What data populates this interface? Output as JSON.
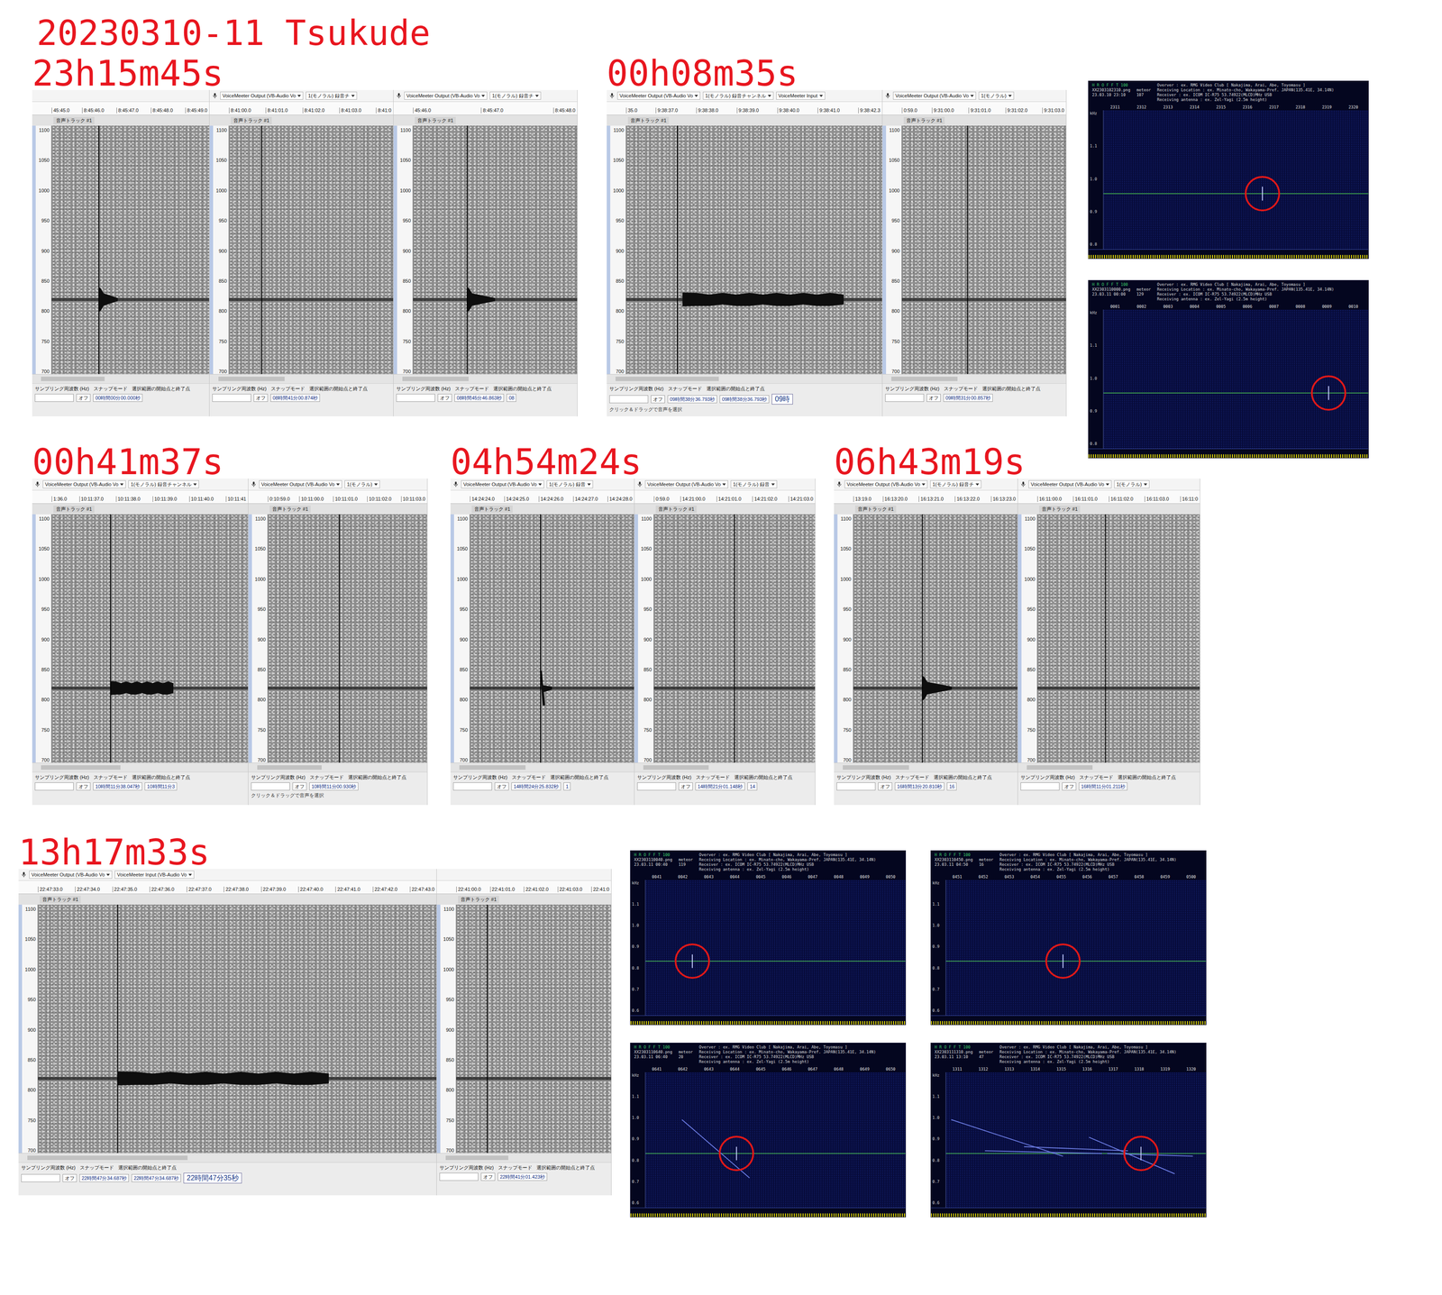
{
  "title": "20230310-11 Tsukude",
  "spectrogram": {
    "track_label": "音声トラック #1",
    "y_ticks": [
      "1100",
      "1050",
      "1000",
      "950",
      "900",
      "850",
      "800",
      "750",
      "700"
    ],
    "toolbar_labels": [
      "サンプリング周波数 (Hz)",
      "スナップモード",
      "選択範囲の開始点と終了点"
    ],
    "snap": "オフ"
  },
  "groups": [
    {
      "label": "23h15m45s",
      "panels": [
        {
          "header": [],
          "ruler": [
            "45:45.0",
            "8:45:46.0",
            "8:45:47.0",
            "8:45:48.0",
            "8:45:49.0"
          ],
          "cursor": 0.3,
          "echo": {
            "kind": "blob",
            "start": 0.3,
            "end": 0.42
          },
          "times": [
            "00時間00分00.000秒"
          ]
        },
        {
          "header": [
            "VoiceMeeter Output (VB-Audio Vo",
            "1(モノラル) 録音チ"
          ],
          "ruler": [
            "8:41:00.0",
            "8:41:01.0",
            "8:41:02.0",
            "8:41:03.0",
            "8:41:0"
          ],
          "cursor": 0.2,
          "echo": {
            "kind": "none",
            "start": 0.2,
            "end": 0.2
          },
          "times": [
            "08時間41分00.874秒"
          ]
        },
        {
          "header": [
            "VoiceMeeter Output (VB-Audio Vo",
            "1(モノラル) 録音チ"
          ],
          "ruler": [
            "45:46.0",
            "8:45:47.0",
            "8:45:48.0"
          ],
          "cursor": 0.33,
          "echo": {
            "kind": "blob",
            "start": 0.33,
            "end": 0.5
          },
          "times": [
            "08時間45分46.863秒",
            "08"
          ]
        }
      ]
    },
    {
      "label": "00h08m35s",
      "panels": [
        {
          "header": [
            "VoiceMeeter Output (VB-Audio Vo",
            "1(モノラル) 録音チャンネル",
            "VoiceMeeter Input"
          ],
          "ruler": [
            "35.0",
            "9:38:37.0",
            "9:38:38.0",
            "9:38:39.0",
            "9:38:40.0",
            "9:38:41.0",
            "9:38:42.3"
          ],
          "cursor": 0.2,
          "echo": {
            "kind": "long",
            "start": 0.22,
            "end": 0.85
          },
          "times": [
            "09時間38分36.793秒",
            "09時間38分36.793秒"
          ],
          "overlay": "09時",
          "status": "クリック＆ドラッグで音声を選択"
        },
        {
          "header": [
            "VoiceMeeter Output (VB-Audio Vo",
            "1(モノラル)"
          ],
          "ruler": [
            "0:59.0",
            "9:31:00.0",
            "9:31:01.0",
            "9:31:02.0",
            "9:31:03.0"
          ],
          "cursor": 0.4,
          "echo": {
            "kind": "none",
            "start": 0.4,
            "end": 0.4
          },
          "times": [
            "09時間31分00.857秒"
          ]
        }
      ]
    },
    {
      "label": "00h41m37s",
      "panels": [
        {
          "header": [
            "VoiceMeeter Output (VB-Audio Vo",
            "1(モノラル) 録音チャンネル"
          ],
          "ruler": [
            "1:36.0",
            "10:11:37.0",
            "10:11:38.0",
            "10:11:39.0",
            "10:11:40.0",
            "10:11:41"
          ],
          "cursor": 0.3,
          "echo": {
            "kind": "long",
            "start": 0.3,
            "end": 0.62
          },
          "times": [
            "10時間11分38.047秒",
            "10時間11分3"
          ]
        },
        {
          "header": [
            "VoiceMeeter Output (VB-Audio Vo",
            "1(モノラル)"
          ],
          "ruler": [
            "0:10:59.0",
            "10:11:00.0",
            "10:11:01.0",
            "10:11:02.0",
            "10:11:03.0"
          ],
          "cursor": 0.45,
          "echo": {
            "kind": "none",
            "start": 0.45,
            "end": 0.45
          },
          "times": [
            "10時間11分00.930秒"
          ],
          "status": "クリック＆ドラッグで音声を選択"
        }
      ]
    },
    {
      "label": "04h54m24s",
      "panels": [
        {
          "header": [
            "VoiceMeeter Output (VB-Audio Vo",
            "1(モノラル) 録音"
          ],
          "ruler": [
            "14:24:24.0",
            "14:24:25.0",
            "14:24:26.0",
            "14:24:27.0",
            "14:24:28.0"
          ],
          "cursor": 0.43,
          "echo": {
            "kind": "head",
            "start": 0.43,
            "end": 0.5
          },
          "times": [
            "14時間24分25.832秒",
            "1"
          ]
        },
        {
          "header": [
            "VoiceMeeter Output (VB-Audio Vo",
            "1(モノラル) 録音"
          ],
          "ruler": [
            "0:59.0",
            "14:21:00.0",
            "14:21:01.0",
            "14:21:02.0",
            "14:21:03.0"
          ],
          "cursor": 0.5,
          "echo": {
            "kind": "none",
            "start": 0.5,
            "end": 0.5
          },
          "times": [
            "14時間21分01.148秒",
            "14"
          ]
        }
      ]
    },
    {
      "label": "06h43m19s",
      "panels": [
        {
          "header": [
            "VoiceMeeter Output (VB-Audio Vo",
            "1(モノラル) 録音チ"
          ],
          "ruler": [
            "13:19.0",
            "16:13:20.0",
            "16:13:21.0",
            "16:13:22.0",
            "16:13:23.0"
          ],
          "cursor": 0.42,
          "echo": {
            "kind": "blob",
            "start": 0.42,
            "end": 0.6
          },
          "times": [
            "16時間13分20.810秒",
            "16"
          ]
        },
        {
          "header": [
            "VoiceMeeter Output (VB-Audio Vo",
            "1(モノラル)"
          ],
          "ruler": [
            "16:11:00.0",
            "16:11:01.0",
            "16:11:02.0",
            "16:11:03.0",
            "16:11:0"
          ],
          "cursor": 0.42,
          "echo": {
            "kind": "none",
            "start": 0.42,
            "end": 0.42
          },
          "times": [
            "16時間11分01.211秒"
          ]
        }
      ]
    },
    {
      "label": "13h17m33s",
      "panels": [
        {
          "header": [
            "VoiceMeeter Output (VB-Audio Vo",
            "VoiceMeeter Input (VB-Audio Vo"
          ],
          "ruler": [
            "22:47:33.0",
            "22:47:34.0",
            "22:47:35.0",
            "22:47:36.0",
            "22:47:37.0",
            "22:47:38.0",
            "22:47:39.0",
            "22:47:40.0",
            "22:47:41.0",
            "22:47:42.0",
            "22:47:43.0"
          ],
          "cursor": 0.2,
          "echo": {
            "kind": "long",
            "start": 0.2,
            "end": 0.73
          },
          "times": [
            "22時間47分34.687秒",
            "22時間47分34.687秒"
          ],
          "overlay": "22時間47分35秒"
        },
        {
          "header": [],
          "ruler": [
            "22:41:00.0",
            "22:41:01.0",
            "22:41:02.0",
            "22:41:03.0",
            "22:41:0"
          ],
          "cursor": 0.2,
          "echo": {
            "kind": "none",
            "start": 0.2,
            "end": 0.2
          },
          "times": [
            "22時間41分01.423秒"
          ]
        }
      ]
    }
  ],
  "hrofft": {
    "title": "H R O F F T 100",
    "meteor_label": "meteor",
    "info": [
      "Overver : ex. RMG Video Club [ Nakajima, Arai, Abe, Toyomasu ]",
      "Receiving Location : ex. Minato-cho, Wakayama-Pref. JAPAN(135.41E, 34.14N)",
      "Receiver : ex. ICOM IC-R75 53.74922(MLCD)MHz USB",
      "Receiving antenna : ex. Zel-Yagi (2.5m height)"
    ],
    "panels": [
      {
        "file": "XX2303102310.png",
        "date": "23.03.10 23:10",
        "count": "107",
        "ticks": [
          "2311",
          "2312",
          "2313",
          "2314",
          "2315",
          "2316",
          "2317",
          "2318",
          "2319",
          "2320"
        ],
        "y_ticks": [
          "kHz",
          "1.1",
          "1.0",
          "0.9",
          "0.8"
        ],
        "marker": 0.6,
        "traces": []
      },
      {
        "file": "XX2303110000.png",
        "date": "23.03.11 00:00",
        "count": "129",
        "ticks": [
          "0001",
          "0002",
          "0003",
          "0004",
          "0005",
          "0006",
          "0007",
          "0008",
          "0009",
          "0010"
        ],
        "y_ticks": [
          "kHz",
          "1.1",
          "1.0",
          "0.9",
          "0.8"
        ],
        "marker": 0.85,
        "traces": []
      },
      {
        "file": "XX2303110040.png",
        "date": "23.03.11 00:40",
        "count": "119",
        "ticks": [
          "0041",
          "0042",
          "0043",
          "0044",
          "0045",
          "0046",
          "0047",
          "0048",
          "0049",
          "0050"
        ],
        "y_ticks": [
          "kHz",
          "1.1",
          "1.0",
          "0.9",
          "0.8",
          "0.7",
          "0.6"
        ],
        "marker": 0.18,
        "traces": []
      },
      {
        "file": "XX2303110450.png",
        "date": "23.03.11 04:50",
        "count": "16",
        "ticks": [
          "0451",
          "0452",
          "0453",
          "0454",
          "0455",
          "0456",
          "0457",
          "0458",
          "0459",
          "0500"
        ],
        "y_ticks": [
          "kHz",
          "1.1",
          "1.0",
          "0.9",
          "0.8",
          "0.7",
          "0.6"
        ],
        "marker": 0.45,
        "traces": []
      },
      {
        "file": "XX2303110640.png",
        "date": "23.03.11 06:40",
        "count": "20",
        "ticks": [
          "0641",
          "0642",
          "0643",
          "0644",
          "0645",
          "0646",
          "0647",
          "0648",
          "0649",
          "0650"
        ],
        "y_ticks": [
          "kHz",
          "1.1",
          "1.0",
          "0.9",
          "0.8",
          "0.7",
          "0.6"
        ],
        "marker": 0.35,
        "traces": [
          [
            0.14,
            0.35,
            0.4,
            0.78
          ]
        ]
      },
      {
        "file": "XX2303111310.png",
        "date": "23.03.11 13:10",
        "count": "47",
        "ticks": [
          "1311",
          "1312",
          "1313",
          "1314",
          "1315",
          "1316",
          "1317",
          "1318",
          "1319",
          "1320"
        ],
        "y_ticks": [
          "kHz",
          "1.1",
          "1.0",
          "0.9",
          "0.8",
          "0.7",
          "0.6"
        ],
        "marker": 0.75,
        "traces": [
          [
            0.02,
            0.35,
            0.45,
            0.62
          ],
          [
            0.15,
            0.58,
            0.6,
            0.6
          ],
          [
            0.3,
            0.55,
            0.7,
            0.58
          ],
          [
            0.55,
            0.48,
            0.88,
            0.75
          ],
          [
            0.62,
            0.6,
            0.95,
            0.62
          ]
        ]
      }
    ]
  }
}
